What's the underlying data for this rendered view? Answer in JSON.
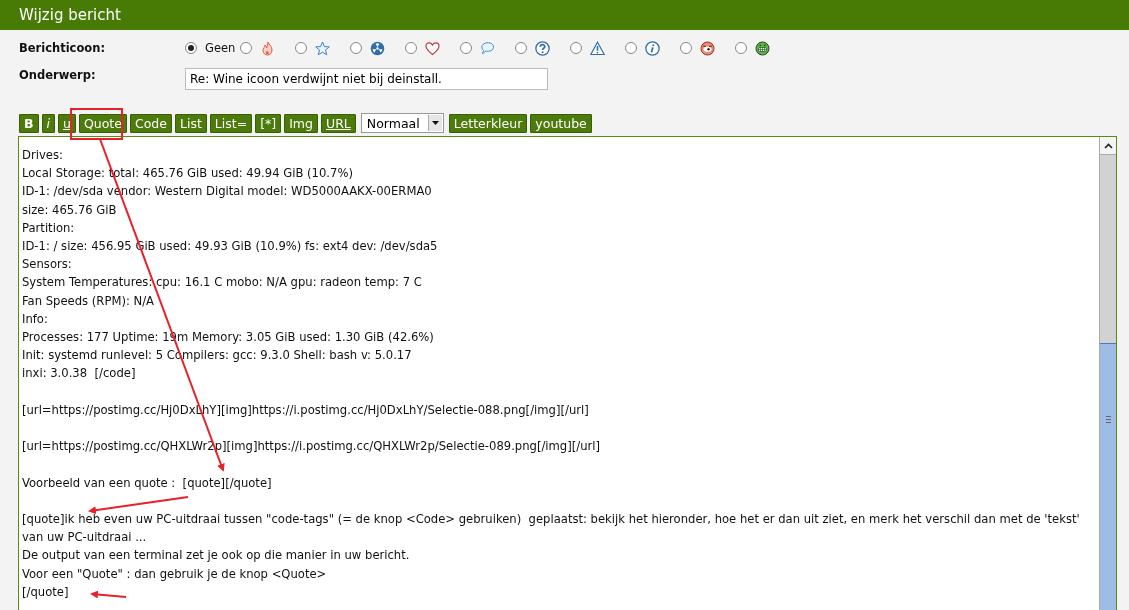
{
  "window": {
    "title": "Wijzig bericht"
  },
  "icon_field": {
    "label": "Berichticoon:",
    "options": [
      {
        "kind": "none",
        "label": "Geen",
        "selected": true
      },
      {
        "kind": "flame",
        "selected": false
      },
      {
        "kind": "star",
        "selected": false
      },
      {
        "kind": "radiation",
        "selected": false
      },
      {
        "kind": "heart",
        "selected": false
      },
      {
        "kind": "speech",
        "selected": false
      },
      {
        "kind": "question",
        "selected": false
      },
      {
        "kind": "warning",
        "selected": false
      },
      {
        "kind": "info",
        "selected": false
      },
      {
        "kind": "face-red",
        "selected": false
      },
      {
        "kind": "face-green",
        "selected": false
      }
    ]
  },
  "subject_field": {
    "label": "Onderwerp:",
    "value": "Re: Wine icoon verdwijnt niet bij deinstall."
  },
  "toolbar": [
    {
      "kind": "bold",
      "label": "B"
    },
    {
      "kind": "italic",
      "label": "i"
    },
    {
      "kind": "underline",
      "label": "u"
    },
    {
      "kind": "plain",
      "label": "Quote"
    },
    {
      "kind": "plain",
      "label": "Code"
    },
    {
      "kind": "plain",
      "label": "List"
    },
    {
      "kind": "plain",
      "label": "List="
    },
    {
      "kind": "plain",
      "label": "[*]"
    },
    {
      "kind": "plain",
      "label": "Img"
    },
    {
      "kind": "underline",
      "label": "URL"
    },
    {
      "kind": "select",
      "label": "Normaal"
    },
    {
      "kind": "plain",
      "label": "Letterkleur"
    },
    {
      "kind": "plain",
      "label": "youtube"
    }
  ],
  "message": {
    "paragraphs": [
      [
        "Drives:",
        "Local Storage: total: 465.76 GiB used: 49.94 GiB (10.7%)",
        "ID-1: /dev/sda vendor: Western Digital model: WD5000AAKX-00ERMA0",
        "size: 465.76 GiB",
        "Partition:",
        "ID-1: / size: 456.95 GiB used: 49.93 GiB (10.9%) fs: ext4 dev: /dev/sda5",
        "Sensors:",
        "System Temperatures: cpu: 16.1 C mobo: N/A gpu: radeon temp: 7 C",
        "Fan Speeds (RPM): N/A",
        "Info:",
        "Processes: 177 Uptime: 19m Memory: 3.05 GiB used: 1.30 GiB (42.6%)",
        "Init: systemd runlevel: 5 Compilers: gcc: 9.3.0 Shell: bash v: 5.0.17",
        "inxi: 3.0.38  [/code]"
      ],
      [
        "[url=https://postimg.cc/Hj0DxLhY][img]https://i.postimg.cc/Hj0DxLhY/Selectie-088.png[/img][/url]"
      ],
      [
        "[url=https://postimg.cc/QHXLWr2p][img]https://i.postimg.cc/QHXLWr2p/Selectie-089.png[/img][/url]"
      ],
      [
        "Voorbeeld van een quote :  [quote][/quote]"
      ],
      [
        "[quote]ik heb even uw PC-uitdraai tussen \"code-tags\" (= de knop <Code> gebruiken)  geplaatst: bekijk het hieronder, hoe het er dan uit ziet, en merk het verschil dan met de 'tekst'",
        "van uw PC-uitdraai ...",
        "De output van een terminal zet je ook op die manier in uw bericht.",
        "Voor een \"Quote\" : dan gebruik je de knop <Quote>",
        "[/quote]"
      ]
    ]
  }
}
